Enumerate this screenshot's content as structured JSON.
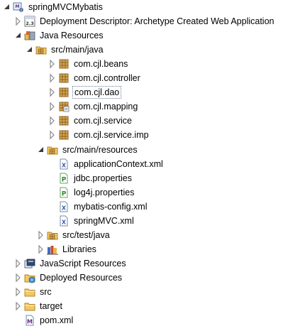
{
  "tree": {
    "project": {
      "label": "springMVCMybatis",
      "icon": "maven-project-icon"
    },
    "deployment_descriptor": {
      "label": "Deployment Descriptor: Archetype Created Web Application",
      "icon": "deployment-descriptor-icon"
    },
    "java_resources": {
      "label": "Java Resources",
      "icon": "java-resources-icon"
    },
    "src_main_java": {
      "label": "src/main/java",
      "icon": "source-folder-icon"
    },
    "packages": [
      {
        "label": "com.cjl.beans",
        "icon": "package-icon"
      },
      {
        "label": "com.cjl.controller",
        "icon": "package-icon"
      },
      {
        "label": "com.cjl.dao",
        "icon": "package-icon"
      },
      {
        "label": "com.cjl.mapping",
        "icon": "package-resource-icon"
      },
      {
        "label": "com.cjl.service",
        "icon": "package-icon"
      },
      {
        "label": "com.cjl.service.imp",
        "icon": "package-icon"
      }
    ],
    "src_main_resources": {
      "label": "src/main/resources",
      "icon": "source-folder-icon"
    },
    "resource_files": [
      {
        "label": "applicationContext.xml",
        "icon": "xml-file-icon"
      },
      {
        "label": "jdbc.properties",
        "icon": "properties-file-icon"
      },
      {
        "label": "log4j.properties",
        "icon": "properties-file-icon"
      },
      {
        "label": "mybatis-config.xml",
        "icon": "xml-file-icon"
      },
      {
        "label": "springMVC.xml",
        "icon": "xml-file-icon"
      }
    ],
    "src_test_java": {
      "label": "src/test/java",
      "icon": "source-folder-icon"
    },
    "libraries": {
      "label": "Libraries",
      "icon": "libraries-icon"
    },
    "javascript_resources": {
      "label": "JavaScript Resources",
      "icon": "javascript-resources-icon"
    },
    "deployed_resources": {
      "label": "Deployed Resources",
      "icon": "deployed-resources-icon"
    },
    "src": {
      "label": "src",
      "icon": "folder-icon"
    },
    "target": {
      "label": "target",
      "icon": "folder-icon"
    },
    "pom": {
      "label": "pom.xml",
      "icon": "maven-pom-icon"
    }
  },
  "colors": {
    "package": "#b88a3c",
    "folder": "#e8b94a",
    "properties": "#2e8b2e",
    "xml": "#4a6fb5",
    "selection_border": "#6b7d95"
  }
}
